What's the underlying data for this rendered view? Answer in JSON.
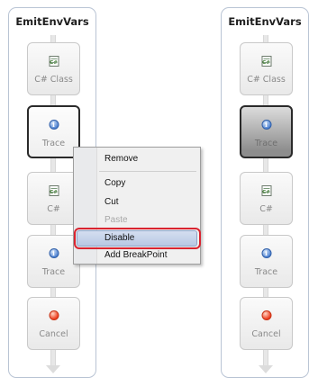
{
  "left_panel": {
    "title": "EmitEnvVars",
    "activities": [
      {
        "label": "C# Class",
        "icon": "csharp-file-icon"
      },
      {
        "label": "Trace",
        "icon": "info-icon"
      },
      {
        "label": "C#",
        "icon": "csharp-file-icon"
      },
      {
        "label": "Trace",
        "icon": "info-icon"
      },
      {
        "label": "Cancel",
        "icon": "red-stop-icon"
      }
    ]
  },
  "right_panel": {
    "title": "EmitEnvVars",
    "activities": [
      {
        "label": "C# Class",
        "icon": "csharp-file-icon"
      },
      {
        "label": "Trace",
        "icon": "info-icon"
      },
      {
        "label": "C#",
        "icon": "csharp-file-icon"
      },
      {
        "label": "Trace",
        "icon": "info-icon"
      },
      {
        "label": "Cancel",
        "icon": "red-stop-icon"
      }
    ]
  },
  "context_menu": {
    "items": [
      {
        "label": "Remove",
        "enabled": true
      },
      {
        "label": "Copy",
        "enabled": true
      },
      {
        "label": "Cut",
        "enabled": true
      },
      {
        "label": "Paste",
        "enabled": false
      },
      {
        "label": "Disable",
        "enabled": true,
        "highlighted": true
      },
      {
        "label": "Add BreakPoint",
        "enabled": true
      }
    ]
  },
  "colors": {
    "highlight_outline": "#d92430",
    "menu_highlight": "#b8c8e4",
    "info_blue": "#4a7fd0",
    "cancel_red": "#ee3d1e"
  }
}
